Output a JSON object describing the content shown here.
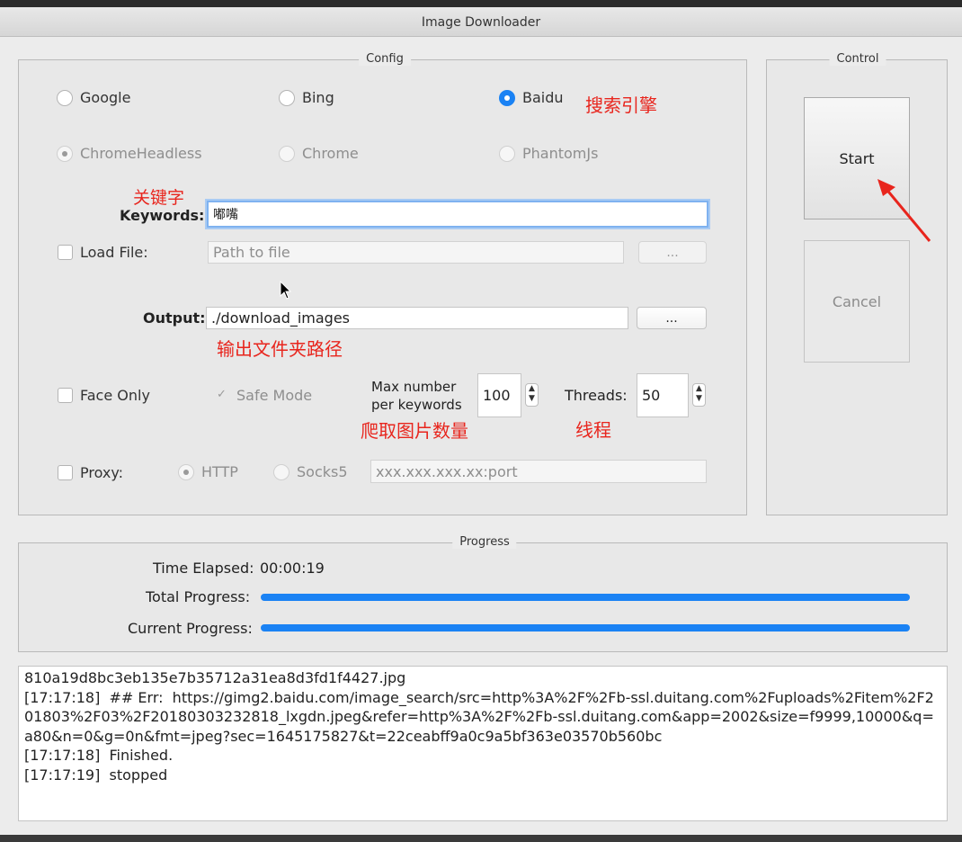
{
  "window": {
    "title": "Image Downloader"
  },
  "config": {
    "legend": "Config",
    "engines": [
      {
        "label": "Google",
        "selected": false
      },
      {
        "label": "Bing",
        "selected": false
      },
      {
        "label": "Baidu",
        "selected": true
      }
    ],
    "drivers": [
      {
        "label": "ChromeHeadless",
        "selected": true
      },
      {
        "label": "Chrome",
        "selected": false
      },
      {
        "label": "PhantomJs",
        "selected": false
      }
    ],
    "keywords_label": "Keywords:",
    "keywords_value": "嘟嘴",
    "load_file_label": "Load File:",
    "path_placeholder": "Path to file",
    "browse_label": "...",
    "output_label": "Output:",
    "output_value": "./download_images",
    "face_only_label": "Face Only",
    "safe_mode_label": "Safe Mode",
    "max_number_label_1": "Max number",
    "max_number_label_2": "per keywords",
    "max_number_value": "100",
    "threads_label": "Threads:",
    "threads_value": "50",
    "proxy_label": "Proxy:",
    "proxy_http": "HTTP",
    "proxy_socks": "Socks5",
    "proxy_placeholder": "xxx.xxx.xxx.xx:port"
  },
  "control": {
    "legend": "Control",
    "start_label": "Start",
    "cancel_label": "Cancel"
  },
  "progress": {
    "legend": "Progress",
    "time_label": "Time Elapsed:",
    "time_value": "00:00:19",
    "total_label": "Total Progress:",
    "total_value": 1.0,
    "current_label": "Current Progress:",
    "current_value": 1.0
  },
  "annotations": {
    "engine": "搜索引擎",
    "keywords": "关键字",
    "output": "输出文件夹路径",
    "max_number": "爬取图片数量",
    "threads": "线程"
  },
  "log": [
    "810a19d8bc3eb135e7b35712a31ea8d3fd1f4427.jpg",
    "[17:17:18]  ## Err:  https://gimg2.baidu.com/image_search/src=http%3A%2F%2Fb-ssl.duitang.com%2Fuploads%2Fitem%2F201803%2F03%2F20180303232818_lxgdn.jpeg&refer=http%3A%2F%2Fb-ssl.duitang.com&app=2002&size=f9999,10000&q=a80&n=0&g=0n&fmt=jpeg?sec=1645175827&t=22ceabff9a0c9a5bf363e03570b560bc",
    "[17:17:18]  Finished.",
    "[17:17:19]  stopped"
  ],
  "colors": {
    "accent": "#1a82f4",
    "annotation": "#e8251d"
  }
}
